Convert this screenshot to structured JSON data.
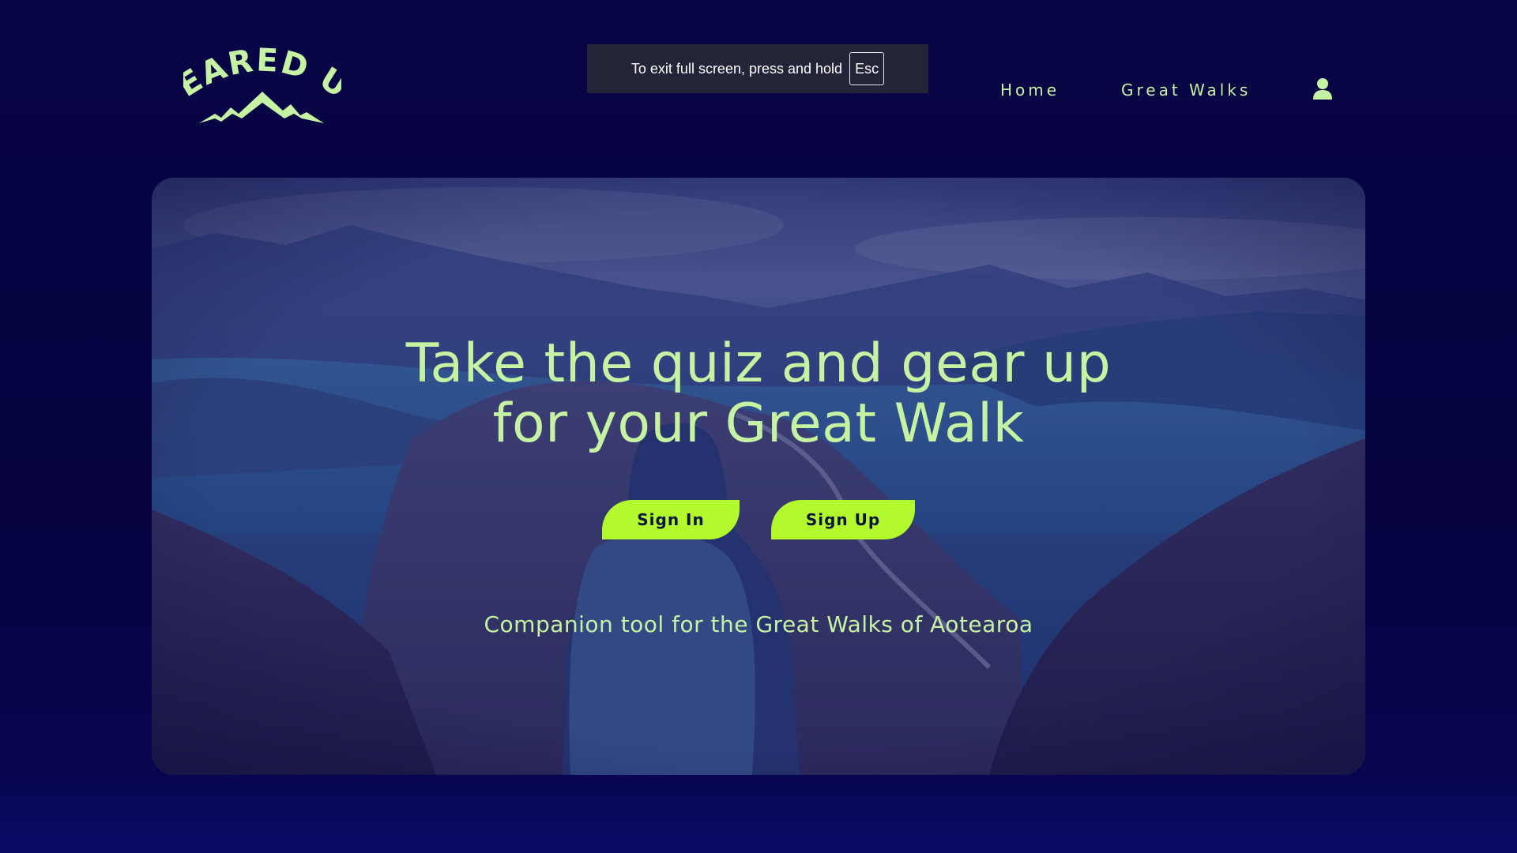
{
  "brand": {
    "name": "GEARED UP",
    "accent_color": "#b2fa2e",
    "text_color": "#c6f3a3",
    "background_color": "#07043f"
  },
  "nav": {
    "home_label": "Home",
    "great_walks_label": "Great Walks",
    "account_icon": "user-icon"
  },
  "fullscreen_toast": {
    "message": "To exit full screen, press and hold",
    "key": "Esc"
  },
  "hero": {
    "title_line1": "Take the quiz and gear up",
    "title_line2": "for your Great Walk",
    "sign_in_label": "Sign In",
    "sign_up_label": "Sign Up",
    "tagline": "Companion tool for the Great Walks of Aotearoa"
  }
}
